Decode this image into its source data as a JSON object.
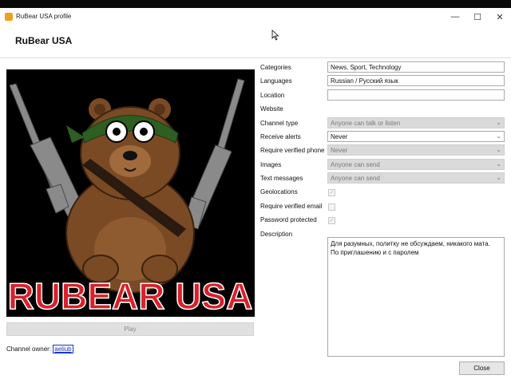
{
  "window": {
    "title": "RuBear USA profile"
  },
  "header": {
    "title": "RuBear USA"
  },
  "avatar": {
    "banner_text": "RUBEAR USA"
  },
  "play_label": "Play",
  "owner": {
    "label": "Channel owner:",
    "name": "aeliub"
  },
  "form": {
    "categories": {
      "label": "Categories",
      "value": "News, Sport, Technology"
    },
    "languages": {
      "label": "Languages",
      "value": "Russian / Русский язык"
    },
    "location": {
      "label": "Location",
      "value": ""
    },
    "website": {
      "label": "Website"
    },
    "channel_type": {
      "label": "Channel type",
      "value": "Anyone can talk or listen"
    },
    "receive_alerts": {
      "label": "Receive alerts",
      "value": "Never"
    },
    "require_verified_phone": {
      "label": "Require verified phone",
      "value": "Never"
    },
    "images": {
      "label": "Images",
      "value": "Anyone can send"
    },
    "text_messages": {
      "label": "Text messages",
      "value": "Anyone can send"
    },
    "geolocations": {
      "label": "Geolocations"
    },
    "require_verified_email": {
      "label": "Require verified email"
    },
    "password_protected": {
      "label": "Password protected"
    },
    "description": {
      "label": "Description",
      "line1": "Для разумных, политку не обсуждаем, никакого мата.",
      "line2": "По приглашению и с паролем"
    }
  },
  "close_label": "Close",
  "colors": {
    "banner_red": "#d8202a",
    "bear_brown": "#7a4a24",
    "bandana_green": "#2e5e22",
    "link_blue": "#1a34c8"
  }
}
